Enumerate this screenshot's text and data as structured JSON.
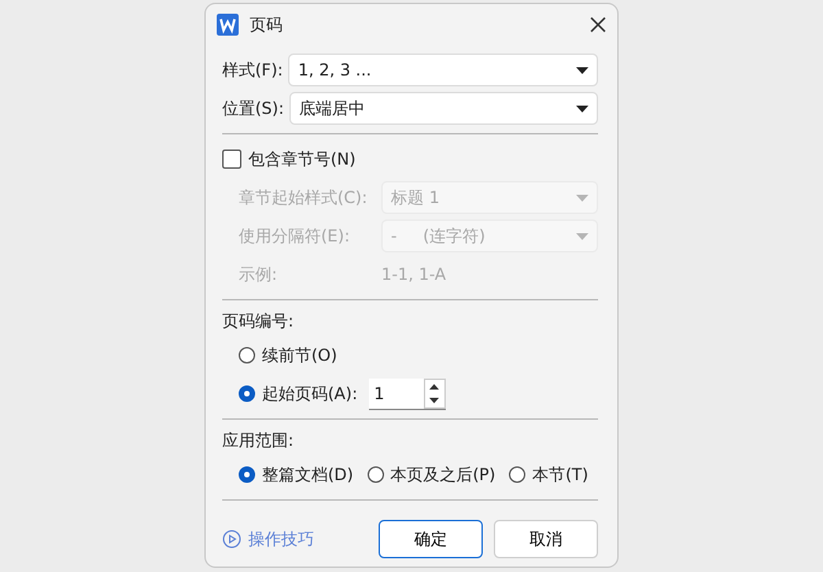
{
  "window": {
    "title": "页码"
  },
  "fields": [
    {
      "label": "样式(F):",
      "value": "1, 2, 3 ...",
      "disabled": false
    },
    {
      "label": "位置(S):",
      "value": "底端居中",
      "disabled": false
    }
  ],
  "include_chapter": {
    "label": "包含章节号(N)",
    "checked": false
  },
  "chapter_fields": [
    {
      "label": "章节起始样式(C):",
      "value": "标题 1",
      "disabled": true
    },
    {
      "label": "使用分隔符(E):",
      "value": "-     (连字符)",
      "disabled": true
    }
  ],
  "example": {
    "label": "示例:",
    "value": "1-1, 1-A",
    "disabled": true
  },
  "numbering": {
    "heading": "页码编号:",
    "options": [
      {
        "label": "续前节(O)",
        "selected": false
      },
      {
        "label": "起始页码(A):",
        "selected": true
      }
    ],
    "start_value": "1"
  },
  "scope": {
    "heading": "应用范围:",
    "options": [
      {
        "label": "整篇文档(D)",
        "selected": true
      },
      {
        "label": "本页及之后(P)",
        "selected": false
      },
      {
        "label": "本节(T)",
        "selected": false
      }
    ]
  },
  "tips_link": "操作技巧",
  "buttons": [
    {
      "label": "确定",
      "primary": true
    },
    {
      "label": "取消",
      "primary": false
    }
  ]
}
